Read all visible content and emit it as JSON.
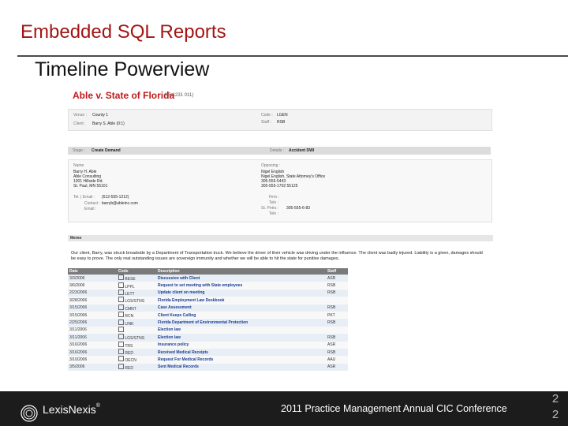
{
  "slide": {
    "title": "Embedded SQL Reports",
    "subtitle": "Timeline Powerview"
  },
  "case": {
    "title": "Able v. State of Florida",
    "number": "(05-1231 011)",
    "venue_label": "Venue :",
    "venue": "County 1",
    "client_label": "Client :",
    "client": "Barry S. Able (0:1)",
    "code_label": "Code :",
    "code": "LGEN",
    "staff_label": "Staff :",
    "staff": "RSB",
    "stage_label": "Stage :",
    "stage": "Create Demand",
    "details_label": "Details :",
    "details": "Accident DWI",
    "name_label": "Name",
    "client_address": [
      "Barry H. Able",
      "Able Consulting",
      "1001 Hillside Rd.",
      "St. Paul, MN 55101"
    ],
    "tel_label": "Tel. | Email :",
    "tel": "(612-555-1212)",
    "contact_label": "Contact :",
    "email_label": "Email :",
    "email": "barryb@ableinc.com",
    "opposing_label": "Opposing :",
    "opposing": [
      "Nigel English",
      "Nigel English, State Attorney's Office",
      "305-555-5443",
      "305-555-1702  55125"
    ],
    "firm_fields": [
      "Firm :",
      "Tele :",
      "St. Petru :",
      "Tele :"
    ],
    "firm_phone": "305-555-6-83"
  },
  "memo": {
    "heading": "Memo",
    "text": "Our client, Barry, was struck broadside by a Department of Transportation truck. We believe the driver of their vehicle was driving under the influence. The client was badly injured. Liability is a given, damages should be easy to prove. The only real outstanding issues are sovereign immunity and whether we will be able to hit the state for punitive damages."
  },
  "timeline": {
    "headers": [
      "Date",
      "Code",
      "Description",
      "Staff"
    ],
    "rows": [
      {
        "date": "3/3/2006",
        "code": "BESE",
        "desc": "Discussion with Client",
        "staff": "ASR"
      },
      {
        "date": "3/6/2006",
        "code": "LPPL",
        "desc": "Request to set meeting with State employees",
        "staff": "RSB"
      },
      {
        "date": "2/23/2006",
        "code": "LETT",
        "desc": "Update client on meeting",
        "staff": "RSB"
      },
      {
        "date": "3/28/2006",
        "code": "LGS/STNS",
        "desc": "Florida Employment Law Deskbook",
        "staff": ""
      },
      {
        "date": "3/15/2006",
        "code": "CMNT",
        "desc": "Case Assessment",
        "staff": "RSB"
      },
      {
        "date": "3/15/2006",
        "code": "RCN",
        "desc": "Client Keeps Calling",
        "staff": "PKT"
      },
      {
        "date": "2/25/2006",
        "code": "LINK",
        "desc": "Florida Department of Environmental Protection",
        "staff": "RSB"
      },
      {
        "date": "3/11/2006",
        "code": "",
        "desc": "Election law",
        "staff": ""
      },
      {
        "date": "3/11/2006",
        "code": "LGS/STNS",
        "desc": "Election law",
        "staff": "RSB"
      },
      {
        "date": "3/16/2006",
        "code": "TRS",
        "desc": "Insurance policy",
        "staff": "ASR"
      },
      {
        "date": "3/16/2006",
        "code": "RED",
        "desc": "Received Medical Receipts",
        "staff": "RSB"
      },
      {
        "date": "3/10/2006",
        "code": "OECN",
        "desc": "Request For Medical Records",
        "staff": "AAU"
      },
      {
        "date": "3/5/2006",
        "code": "RED",
        "desc": "Sent Medical Records",
        "staff": "ASR"
      }
    ]
  },
  "footer": {
    "logo": "LexisNexis",
    "trademark": "®",
    "conference": "2011 Practice Management Annual CIC Conference",
    "page_digits": [
      "2",
      "2"
    ]
  },
  "colors": {
    "title": "#a31515",
    "footer_bg": "#1c1c1c",
    "case_title": "#c01a1a"
  }
}
